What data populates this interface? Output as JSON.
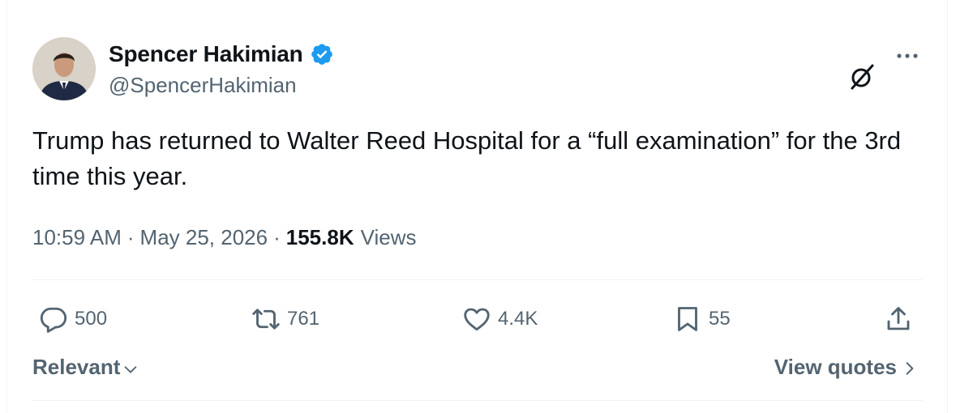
{
  "author": {
    "name": "Spencer Hakimian",
    "handle": "@SpencerHakimian",
    "verified": true,
    "verified_color": "#1d9bf0"
  },
  "tweet": {
    "text": "Trump has returned to Walter Reed Hospital for a “full examination” for the 3rd time this year.",
    "time": "10:59 AM",
    "separator": "·",
    "date": "May 25, 2026",
    "views_count": "155.8K",
    "views_label": "Views"
  },
  "actions": {
    "replies": "500",
    "reposts": "761",
    "likes": "4.4K",
    "bookmarks": "55"
  },
  "footer": {
    "sort_label": "Relevant",
    "view_quotes_label": "View quotes"
  },
  "icons": {
    "verified": "verified-badge-icon",
    "grok": "grok-icon",
    "more": "more-icon",
    "reply": "reply-icon",
    "repost": "repost-icon",
    "like": "heart-icon",
    "bookmark": "bookmark-icon",
    "share": "share-icon",
    "sort": "chevron-down-icon",
    "quotes": "chevron-right-icon"
  },
  "colors": {
    "text_primary": "#0f1419",
    "text_secondary": "#536471",
    "divider": "#eff3f4"
  }
}
